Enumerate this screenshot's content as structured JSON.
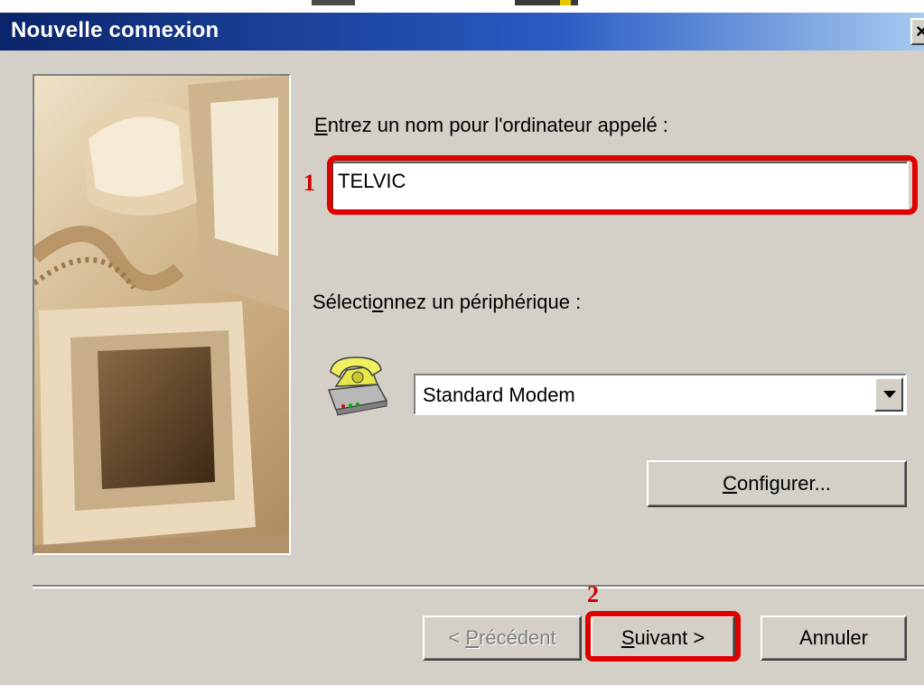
{
  "window": {
    "title": "Nouvelle connexion",
    "close_glyph": "×"
  },
  "name_field": {
    "label_mnemonic": "E",
    "label_rest": "ntrez un nom pour l'ordinateur appelé :",
    "value": "TELVIC"
  },
  "device": {
    "label_pre": "Sélecti",
    "label_mnemonic": "o",
    "label_post": "nnez un périphérique :",
    "selected": "Standard Modem",
    "icon": "modem-phone-icon"
  },
  "configure_button": {
    "mnemonic": "C",
    "rest": "onfigurer..."
  },
  "footer": {
    "back": {
      "pre": "< ",
      "mnemonic": "P",
      "rest": "récédent"
    },
    "next": {
      "mnemonic": "S",
      "rest": "uivant >"
    },
    "cancel": "Annuler"
  },
  "annotations": {
    "marker1": "1",
    "marker2": "2",
    "highlight_color": "#e00000"
  }
}
